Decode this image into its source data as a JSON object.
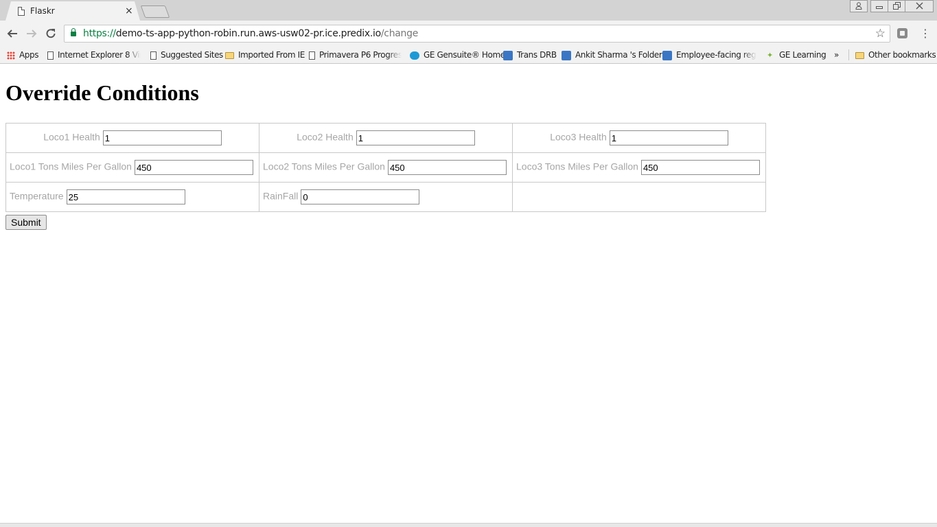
{
  "browser": {
    "tab_title": "Flaskr",
    "tab_close": "×",
    "url_scheme": "https://",
    "url_host": "demo-ts-app-python-robin.run.aws-usw02-pr.ice.predix.io",
    "url_path": "/change",
    "bookmarks": [
      {
        "label": "Apps",
        "icon": "apps-grid-icon"
      },
      {
        "label": "Internet Explorer 8 Virtu",
        "icon": "page-icon"
      },
      {
        "label": "Suggested Sites",
        "icon": "page-icon"
      },
      {
        "label": "Imported From IE",
        "icon": "folder-icon"
      },
      {
        "label": "Primavera P6 Progress F",
        "icon": "page-icon"
      },
      {
        "label": "GE Gensuite® Home",
        "icon": "gensuite-icon"
      },
      {
        "label": "Trans DRB",
        "icon": "ge-logo-icon"
      },
      {
        "label": "Ankit Sharma 's Folders",
        "icon": "ge-logo-icon"
      },
      {
        "label": "Employee-facing registr",
        "icon": "ge-logo-icon"
      },
      {
        "label": "GE Learning",
        "icon": "sprout-icon"
      }
    ],
    "more_bookmarks": "»",
    "other_bookmarks": "Other bookmarks"
  },
  "page": {
    "title": "Override Conditions",
    "fields": {
      "loco1_health": {
        "label": "Loco1 Health",
        "value": "1"
      },
      "loco2_health": {
        "label": "Loco2 Health",
        "value": "1"
      },
      "loco3_health": {
        "label": "Loco3 Health",
        "value": "1"
      },
      "loco1_tmpg": {
        "label": "Loco1 Tons Miles Per Gallon",
        "value": "450"
      },
      "loco2_tmpg": {
        "label": "Loco2 Tons Miles Per Gallon",
        "value": "450"
      },
      "loco3_tmpg": {
        "label": "Loco3 Tons Miles Per Gallon",
        "value": "450"
      },
      "temperature": {
        "label": "Temperature",
        "value": "25"
      },
      "rainfall": {
        "label": "RainFall",
        "value": "0"
      }
    },
    "submit_label": "Submit"
  }
}
